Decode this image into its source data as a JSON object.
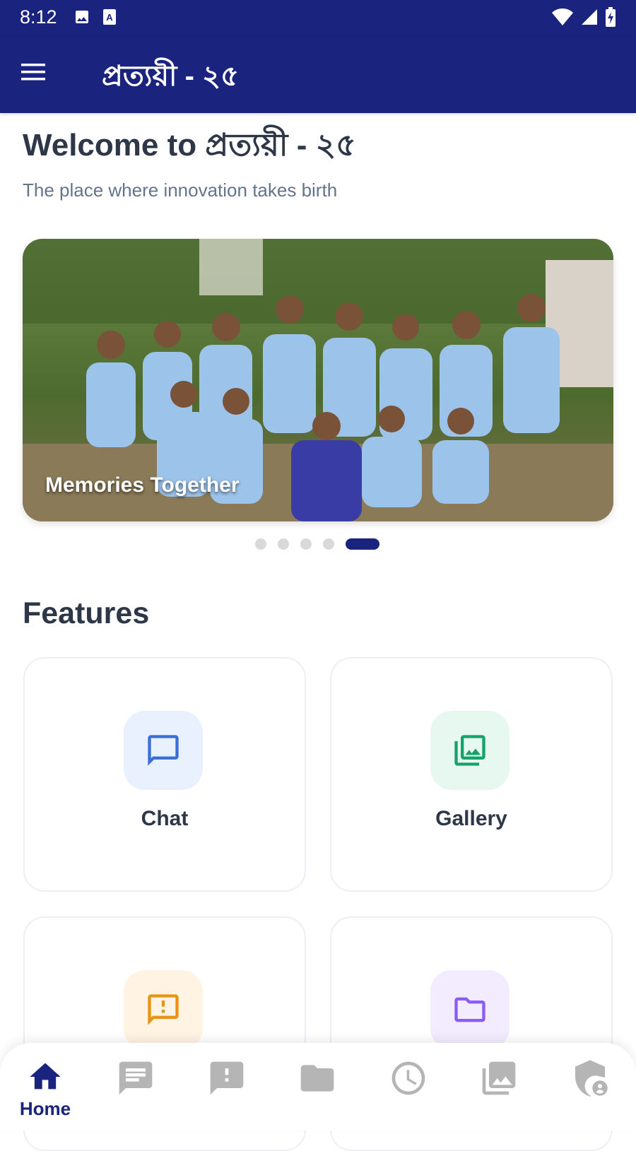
{
  "status_bar": {
    "time": "8:12"
  },
  "app_bar": {
    "title": "প্রত্যয়ী - ২৫"
  },
  "welcome": {
    "title": "Welcome to প্রত্যয়ী - ২৫",
    "subtitle": "The place where innovation takes birth"
  },
  "carousel": {
    "caption": "Memories Together",
    "slide_count": 5,
    "active_index": 4
  },
  "features": {
    "title": "Features",
    "cards": [
      {
        "label": "Chat",
        "icon": "chat-icon",
        "color": "#3b6fd8",
        "bg": "#eaf1fe"
      },
      {
        "label": "Gallery",
        "icon": "gallery-icon",
        "color": "#16a36a",
        "bg": "#e6f8f0"
      },
      {
        "label": "",
        "icon": "report-icon",
        "color": "#e89412",
        "bg": "#fff4e3"
      },
      {
        "label": "",
        "icon": "folder-icon",
        "color": "#8b5cf6",
        "bg": "#f2ecfe"
      }
    ]
  },
  "bottom_nav": {
    "active": "home",
    "items": [
      {
        "key": "home",
        "label": "Home",
        "icon": "home-icon"
      },
      {
        "key": "chat",
        "label": "",
        "icon": "chat-bubble-icon"
      },
      {
        "key": "notice",
        "label": "",
        "icon": "alert-bubble-icon"
      },
      {
        "key": "files",
        "label": "",
        "icon": "folder-icon"
      },
      {
        "key": "history",
        "label": "",
        "icon": "clock-icon"
      },
      {
        "key": "gallery",
        "label": "",
        "icon": "photo-library-icon"
      },
      {
        "key": "admin",
        "label": "",
        "icon": "admin-shield-icon"
      }
    ]
  },
  "colors": {
    "primary": "#1a237e",
    "text_dark": "#2d3748",
    "text_muted": "#64748b",
    "nav_inactive": "#b5b5b5"
  }
}
